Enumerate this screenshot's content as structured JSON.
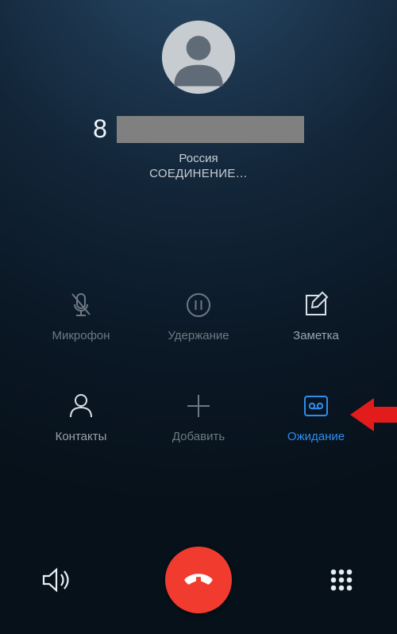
{
  "call": {
    "number_prefix": "8",
    "country": "Россия",
    "status": "СОЕДИНЕНИЕ…"
  },
  "actions": {
    "mute": {
      "label": "Микрофон",
      "enabled": false
    },
    "hold": {
      "label": "Удержание",
      "enabled": false
    },
    "note": {
      "label": "Заметка",
      "enabled": true
    },
    "contacts": {
      "label": "Контакты",
      "enabled": true
    },
    "add": {
      "label": "Добавить",
      "enabled": false
    },
    "waiting": {
      "label": "Ожидание",
      "enabled": true,
      "active": true
    }
  },
  "colors": {
    "accent": "#2f8df0",
    "hangup": "#f23b2f",
    "annotation": "#e21b1b"
  }
}
